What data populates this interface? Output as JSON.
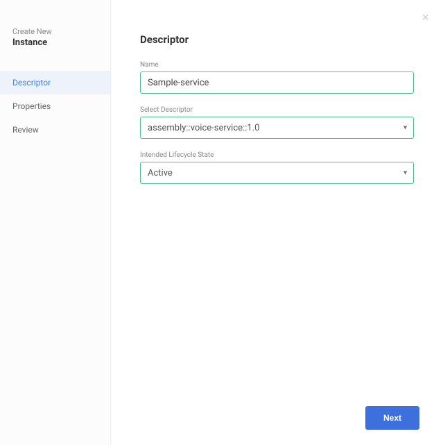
{
  "sidebar": {
    "subtitle": "Create New",
    "title": "Instance",
    "nav": [
      {
        "label": "Descriptor",
        "active": true
      },
      {
        "label": "Properties",
        "active": false
      },
      {
        "label": "Review",
        "active": false
      }
    ]
  },
  "main": {
    "title": "Descriptor",
    "fields": {
      "name": {
        "label": "Name",
        "value": "Sample-service"
      },
      "descriptor": {
        "label": "Select Descriptor",
        "value": "assembly::voice-service::1.0"
      },
      "lifecycle": {
        "label": "Intended Lifecycle State",
        "value": "Active"
      }
    },
    "close_label": "×",
    "next_label": "Next"
  }
}
